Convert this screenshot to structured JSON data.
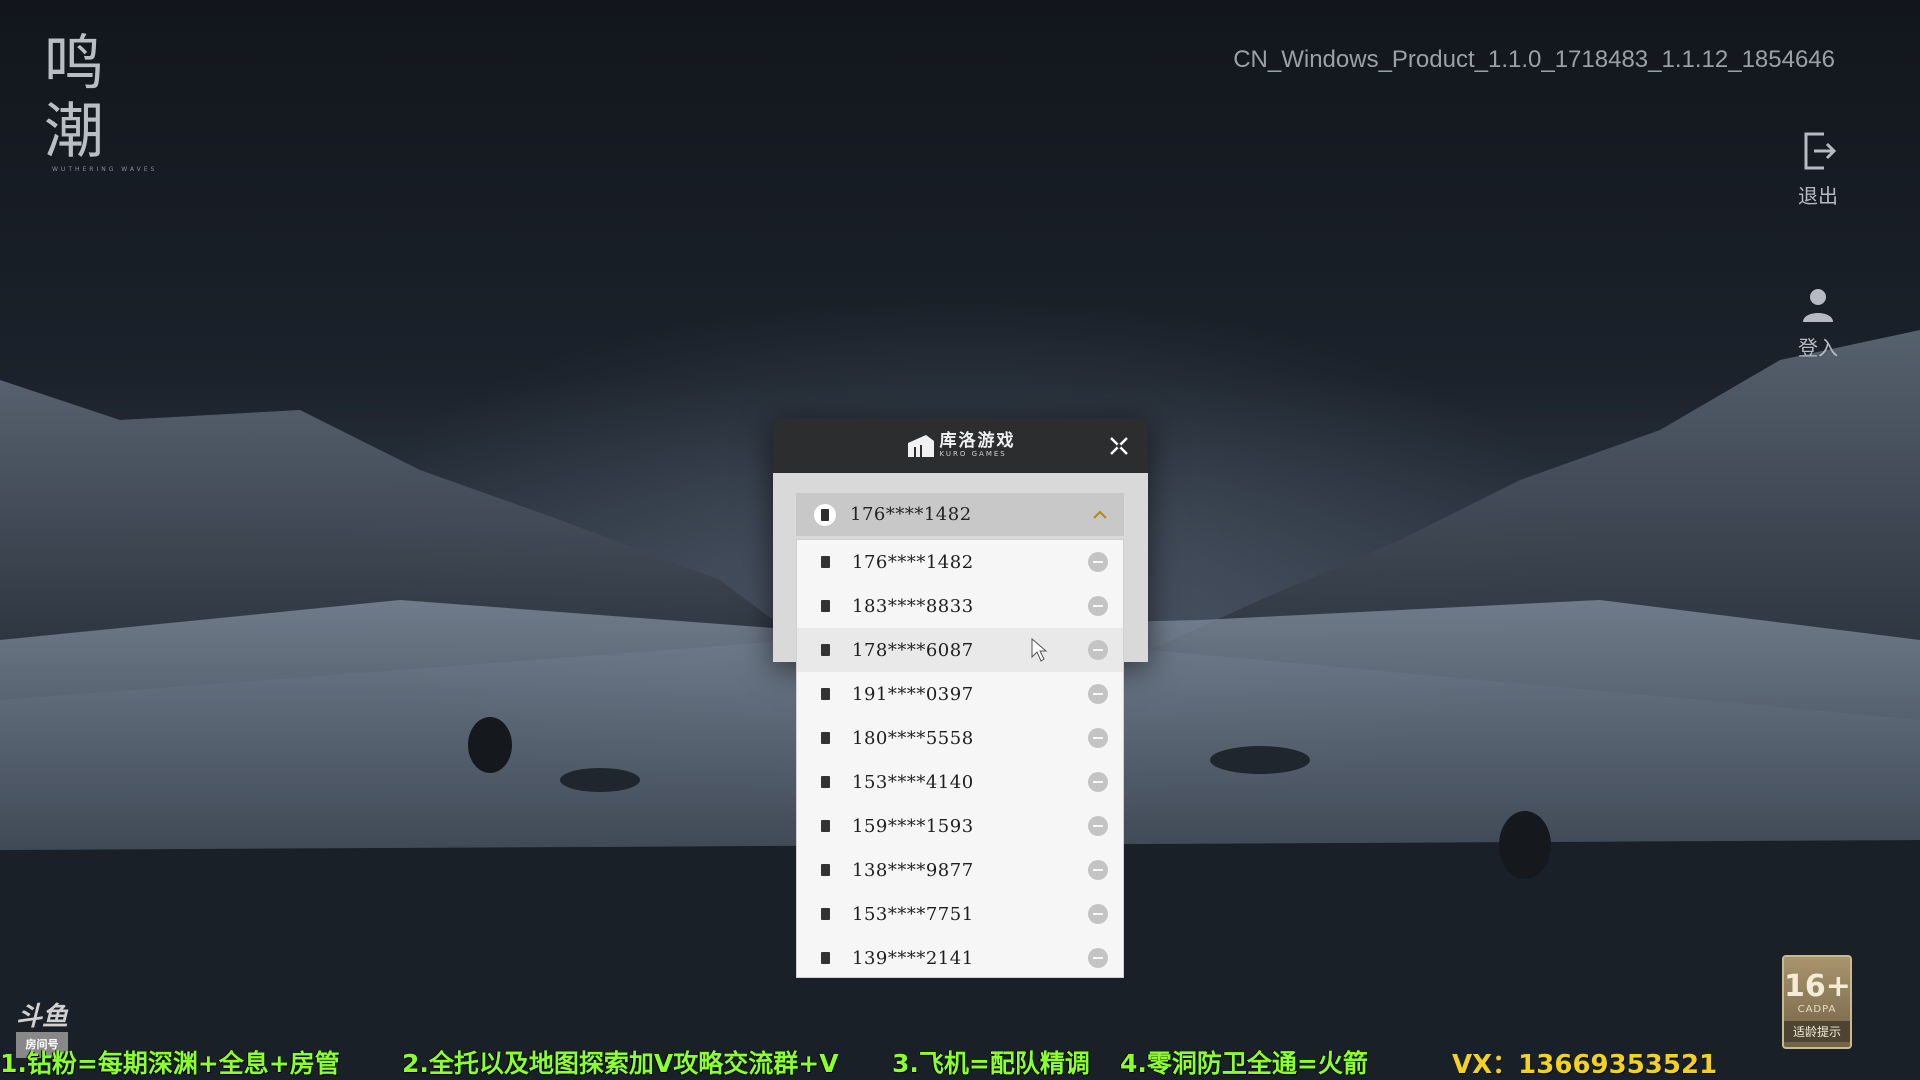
{
  "app": {
    "logo_text": "鸣潮",
    "logo_subtext": "WUTHERING WAVES",
    "build_version": "CN_Windows_Product_1.1.0_1718483_1.1.12_1854646"
  },
  "side_buttons": {
    "exit_label": "退出",
    "login_label": "登入"
  },
  "dialog": {
    "brand_cn": "库洛游戏",
    "brand_en": "KURO GAMES",
    "selected_account": "176****1482",
    "accounts": [
      "176****1482",
      "183****8833",
      "178****6087",
      "191****0397",
      "180****5558",
      "153****4140",
      "159****1593",
      "138****9877",
      "153****7751",
      "139****2141"
    ],
    "hovered_index": 2
  },
  "overlay": {
    "stream_logo": "斗鱼",
    "stream_logo_sub": "房间号",
    "ticker": [
      "1.钻粉=每期深渊+全息+房管",
      "2.全托以及地图探索加V攻略交流群+V",
      "3.飞机=配队精调",
      "4.零洞防卫全通=火箭"
    ],
    "vx": "VX：13669353521",
    "age_rating": "16+",
    "age_org": "CADPA",
    "age_tip": "适龄提示"
  },
  "colors": {
    "ticker_green": "#8cff2e",
    "vx_yellow": "#f2d21f",
    "dialog_header": "#2c2d2f"
  }
}
